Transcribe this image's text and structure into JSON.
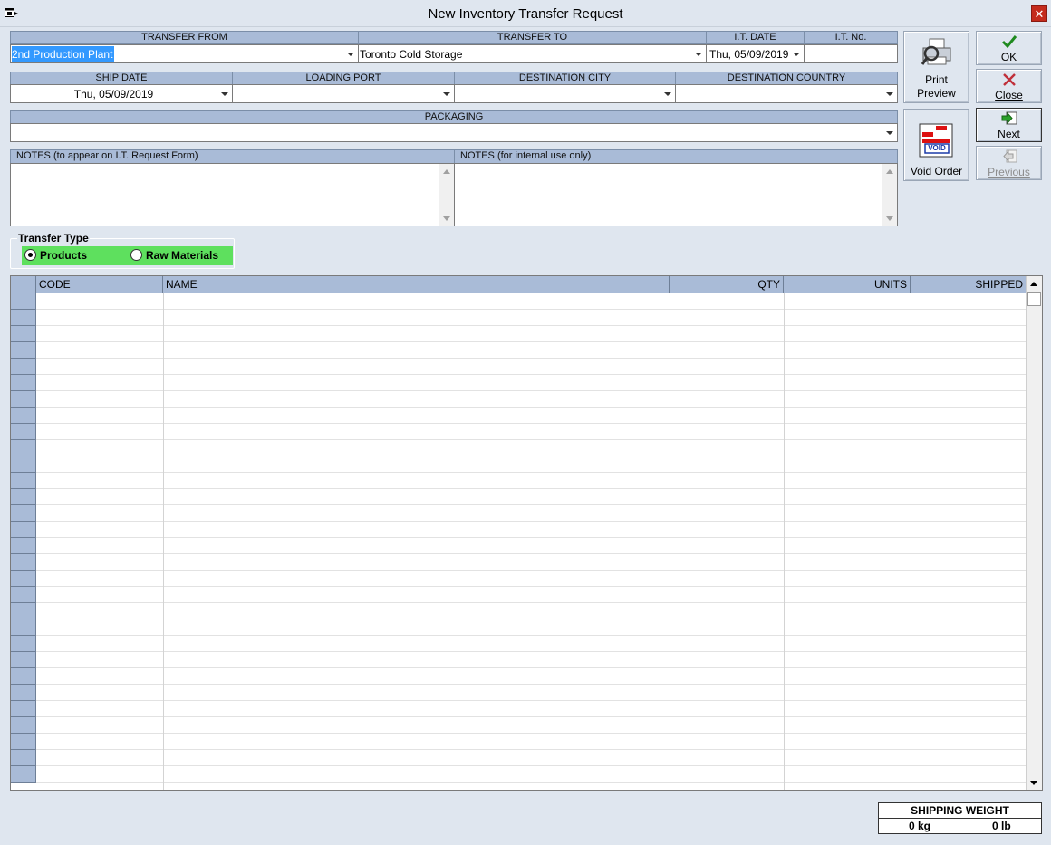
{
  "window": {
    "title": "New Inventory Transfer Request"
  },
  "header": {
    "transfer_from": {
      "label": "TRANSFER FROM",
      "value": "2nd Production Plant"
    },
    "transfer_to": {
      "label": "TRANSFER TO",
      "value": "Toronto Cold Storage"
    },
    "it_date": {
      "label": "I.T. DATE",
      "value": "Thu, 05/09/2019"
    },
    "it_no": {
      "label": "I.T. No.",
      "value": ""
    },
    "ship_date": {
      "label": "SHIP DATE",
      "value": "Thu, 05/09/2019"
    },
    "loading_port": {
      "label": "LOADING PORT",
      "value": ""
    },
    "destination_city": {
      "label": "DESTINATION CITY",
      "value": ""
    },
    "destination_country": {
      "label": "DESTINATION COUNTRY",
      "value": ""
    },
    "packaging": {
      "label": "PACKAGING",
      "value": ""
    }
  },
  "notes": {
    "external_label": "NOTES (to appear on I.T. Request Form)",
    "internal_label": "NOTES (for internal use only)",
    "external_value": "",
    "internal_value": ""
  },
  "buttons": {
    "print_preview_line1": "Print",
    "print_preview_line2": "Preview",
    "ok": "OK",
    "close": "Close",
    "next": "Next",
    "previous": "Previous",
    "void_order": "Void Order",
    "void_stamp": "VOID"
  },
  "transfer_type": {
    "title": "Transfer Type",
    "options": [
      "Products",
      "Raw Materials"
    ],
    "selected": "Products"
  },
  "grid": {
    "columns": [
      "CODE",
      "NAME",
      "QTY",
      "UNITS",
      "SHIPPED"
    ]
  },
  "shipping_weight": {
    "title": "SHIPPING WEIGHT",
    "kg": "0 kg",
    "lb": "0 lb"
  },
  "colors": {
    "header_band": "#a9bbd7",
    "selection": "#3399ff",
    "radio_band": "#5ee05e",
    "window_bg": "#dfe6ef"
  },
  "icons": [
    "app-icon",
    "close-window-icon",
    "printer-icon",
    "checkmark-icon",
    "x-icon",
    "next-arrow-icon",
    "previous-arrow-icon",
    "void-order-icon"
  ]
}
